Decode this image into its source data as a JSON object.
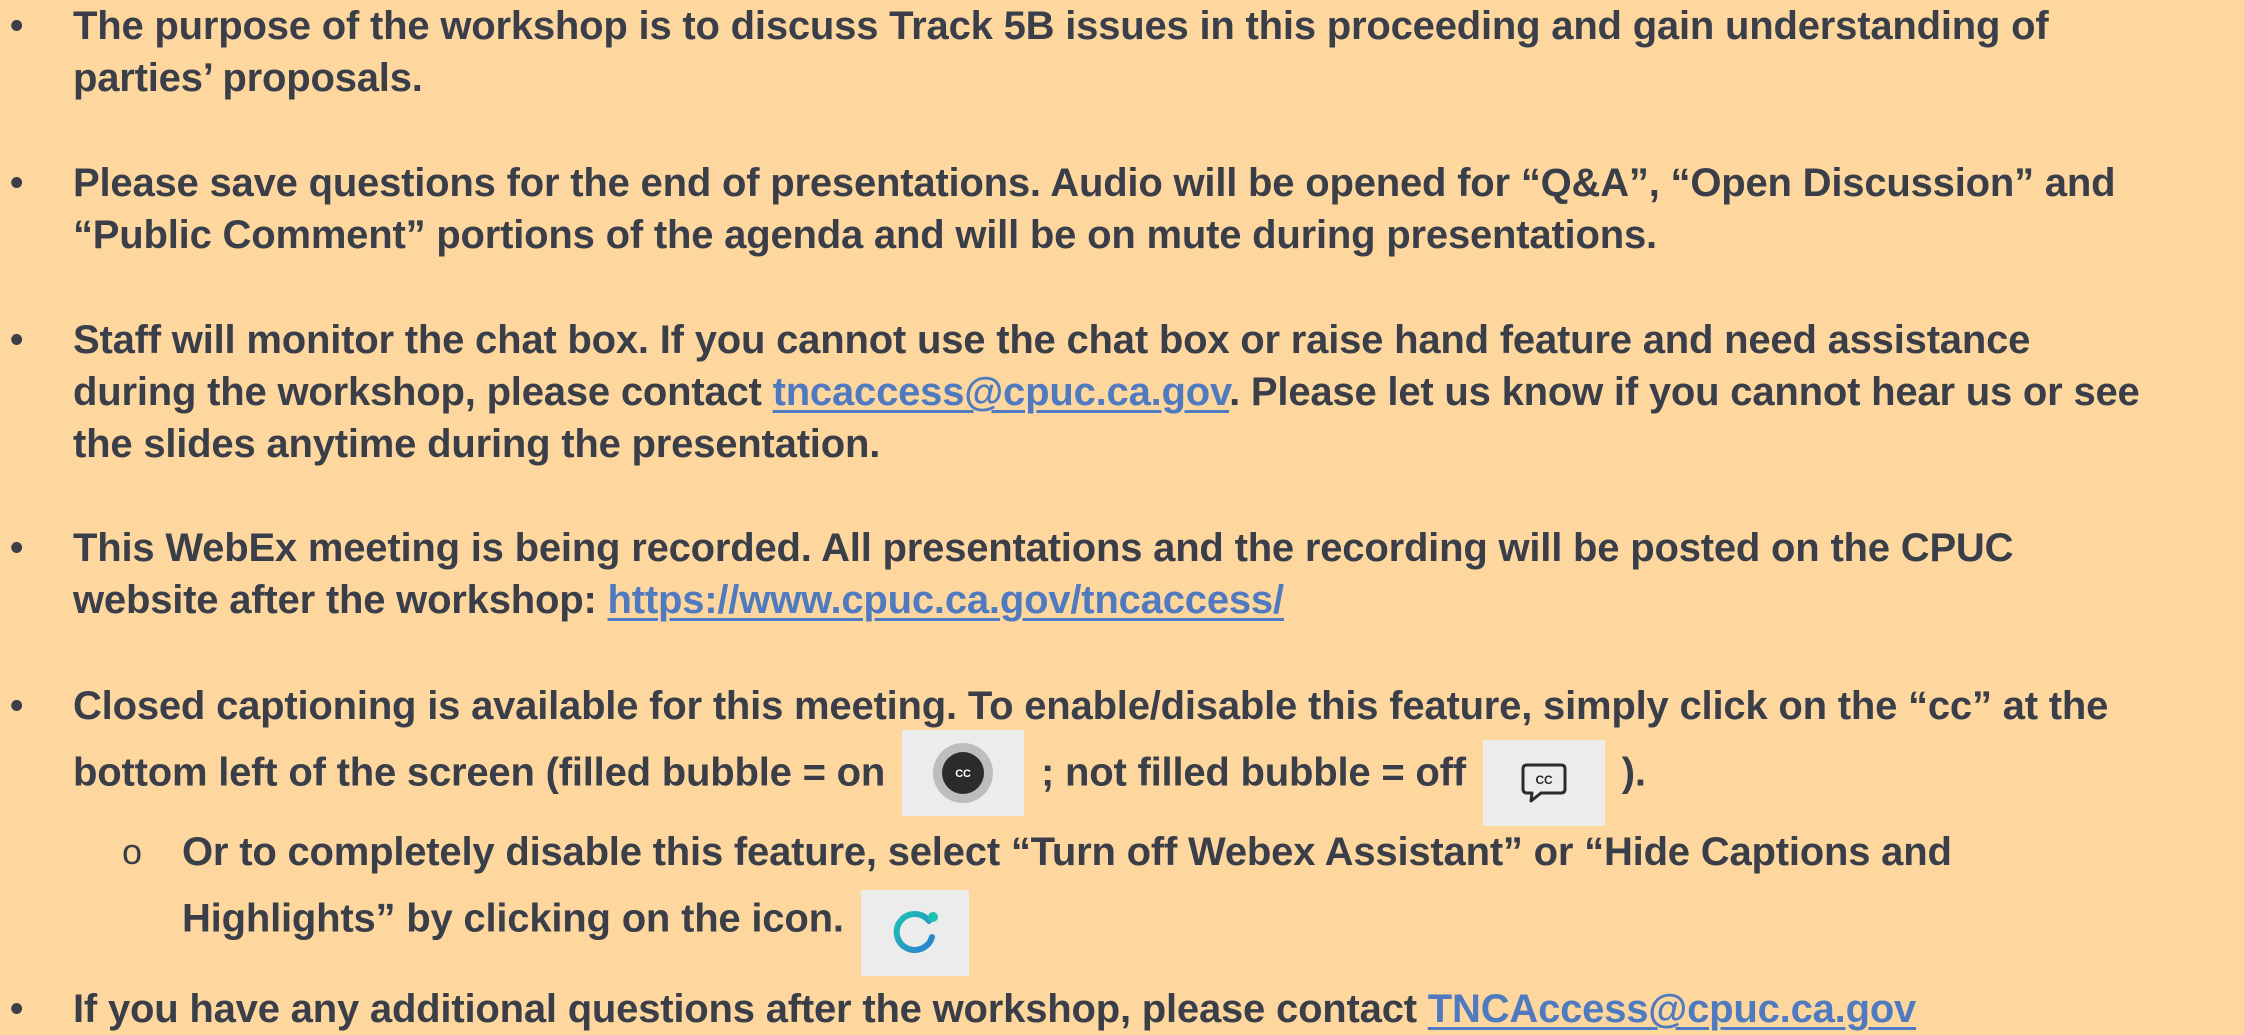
{
  "bullets": [
    {
      "line1": "The purpose of the workshop is to discuss Track 5B issues in this proceeding and gain understanding of",
      "line2": "parties’ proposals."
    },
    {
      "line1": "Please save questions for the end of presentations. Audio will be opened for “Q&A”, “Open Discussion” and",
      "line2": "“Public Comment” portions of the agenda and will be on mute during presentations."
    },
    {
      "line1": "Staff will monitor the chat box. If you cannot use the chat box or raise hand feature and need assistance",
      "line2_pre": "during the workshop, please contact ",
      "line2_link": "tncaccess@cpuc.ca.gov",
      "line2_post": ". Please let us know if you cannot hear us or see",
      "line3": "the slides anytime during the presentation."
    },
    {
      "line1": "This WebEx meeting is being recorded. All presentations and the recording will be posted on the CPUC",
      "line2_pre": "website after the workshop:  ",
      "line2_link": "https://www.cpuc.ca.gov/tncaccess/"
    },
    {
      "line1": "Closed captioning is available for this meeting. To enable/disable this feature, simply click on the “cc” at the",
      "line2_pre": "bottom left of the screen (filled bubble = on ",
      "line2_mid": " ;  not filled bubble = off ",
      "line2_post": " )."
    },
    {
      "line1_pre": "If you have any additional questions after the workshop, please contact ",
      "line1_link": "TNCAccess@cpuc.ca.gov"
    }
  ],
  "sub_bullet": {
    "marker": "o",
    "line1": "Or to completely disable this feature, select “Turn off Webex Assistant” or “Hide Captions and",
    "line2": "Highlights” by clicking on the icon. "
  },
  "bullet_marker": "•",
  "icons": {
    "cc_on": "cc-filled-bubble-icon",
    "cc_off": "cc-outline-bubble-icon",
    "assistant": "webex-assistant-icon"
  },
  "colors": {
    "background": "#fed79f",
    "text": "#3a3e49",
    "link": "#4f7ac0",
    "assistant_teal": "#1ec2b0",
    "assistant_blue": "#2a7fd4"
  }
}
